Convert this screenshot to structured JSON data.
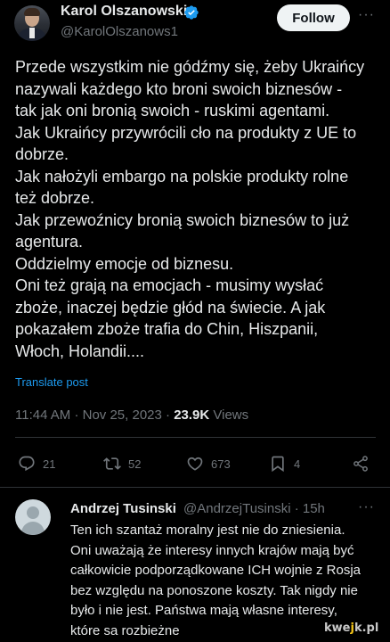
{
  "tweet": {
    "author_name": "Karol Olszanowski",
    "author_handle": "@KarolOlszanows1",
    "follow_label": "Follow",
    "more_label": "···",
    "text_lines": [
      "Przede wszystkim nie gódźmy się, żeby Ukraińcy",
      "nazywali każdego kto broni swoich biznesów -",
      "tak jak oni bronią swoich - ruskimi agentami.",
      "Jak Ukraińcy przywrócili cło na produkty z UE to",
      "dobrze.",
      "Jak nałożyli embargo na polskie produkty rolne",
      "też dobrze.",
      "Jak przewoźnicy bronią swoich biznesów to już",
      "agentura.",
      "Oddzielmy emocje od biznesu.",
      "Oni też grają na emocjach - musimy wysłać",
      "zboże, inaczej będzie głód na świecie. A jak",
      "pokazałem zboże trafia do Chin, Hiszpanii,",
      "Włoch, Holandii...."
    ],
    "translate_label": "Translate post",
    "time": "11:44 AM",
    "dot": "·",
    "date": "Nov 25, 2023",
    "views_count": "23.9K",
    "views_label": "Views",
    "actions": {
      "replies": "21",
      "reposts": "52",
      "likes": "673",
      "bookmarks": "4"
    }
  },
  "reply": {
    "author_name": "Andrzej Tusinski",
    "author_handle": "@AndrzejTusinski · 15h",
    "more_label": "···",
    "text_lines": [
      "Ten ich szantaż moralny jest nie do zniesienia.",
      "Oni uważają że interesy innych krajów mają być",
      "całkowicie podporządkowane ICH wojnie z Rosja",
      "bez względu na ponoszone koszty. Tak nigdy nie",
      "było i nie jest. Państwa mają własne interesy,",
      "które sa rozbieżne"
    ]
  },
  "watermark": {
    "part1": "kwe",
    "part2": "j",
    "part3": "k.pl"
  },
  "colors": {
    "background": "#000000",
    "text": "#e7e9ea",
    "secondary": "#71767b",
    "accent": "#1d9bf0",
    "divider": "#2f3336"
  }
}
